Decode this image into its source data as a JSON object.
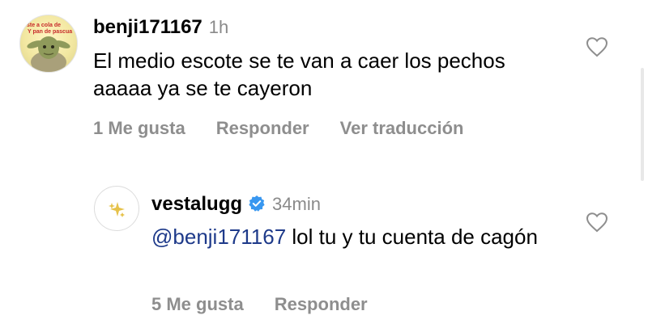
{
  "comments": [
    {
      "username": "benji171167",
      "time": "1h",
      "text": "El medio escote se te van a caer los pechos aaaaa ya se te cayeron",
      "actions": {
        "likes": "1 Me gusta",
        "reply": "Responder",
        "translate": "Ver traducción"
      },
      "avatar_caption": [
        "ste a cola de",
        "Y pan de pascua"
      ]
    }
  ],
  "replies": [
    {
      "username": "vestalugg",
      "verified": true,
      "time": "34min",
      "mention": "@benji171167",
      "text": " lol tu y tu cuenta de cagón",
      "actions": {
        "likes": "5 Me gusta",
        "reply": "Responder"
      },
      "avatar_icon": "sparkles-icon"
    }
  ],
  "icons": {
    "like": "heart-outline-icon",
    "verified": "verified-badge-icon"
  },
  "colors": {
    "mention": "#1e3a8a",
    "verified": "#3897f0",
    "muted": "#8e8e8e"
  }
}
